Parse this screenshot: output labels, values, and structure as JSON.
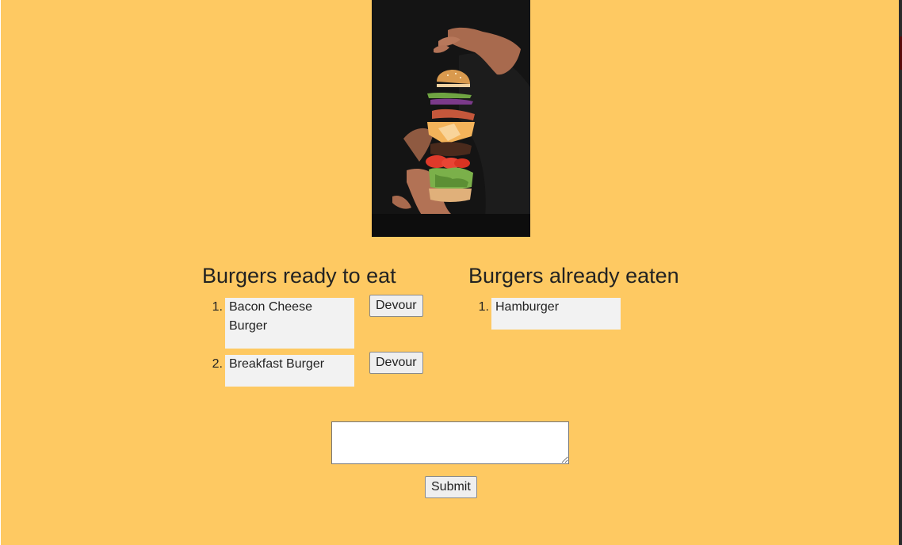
{
  "ready": {
    "title": "Burgers ready to eat",
    "items": [
      {
        "number": "1.",
        "name": "Bacon Cheese Burger",
        "action": "Devour"
      },
      {
        "number": "2.",
        "name": "Breakfast Burger",
        "action": "Devour"
      }
    ]
  },
  "eaten": {
    "title": "Burgers already eaten",
    "items": [
      {
        "number": "1.",
        "name": "Hamburger"
      }
    ]
  },
  "form": {
    "textarea_value": "",
    "submit_label": "Submit"
  },
  "colors": {
    "background": "#fec962",
    "item_background": "#f2f2f2",
    "hero_background": "#131313"
  },
  "hero_image": {
    "icon": "floating-burger-photo"
  }
}
